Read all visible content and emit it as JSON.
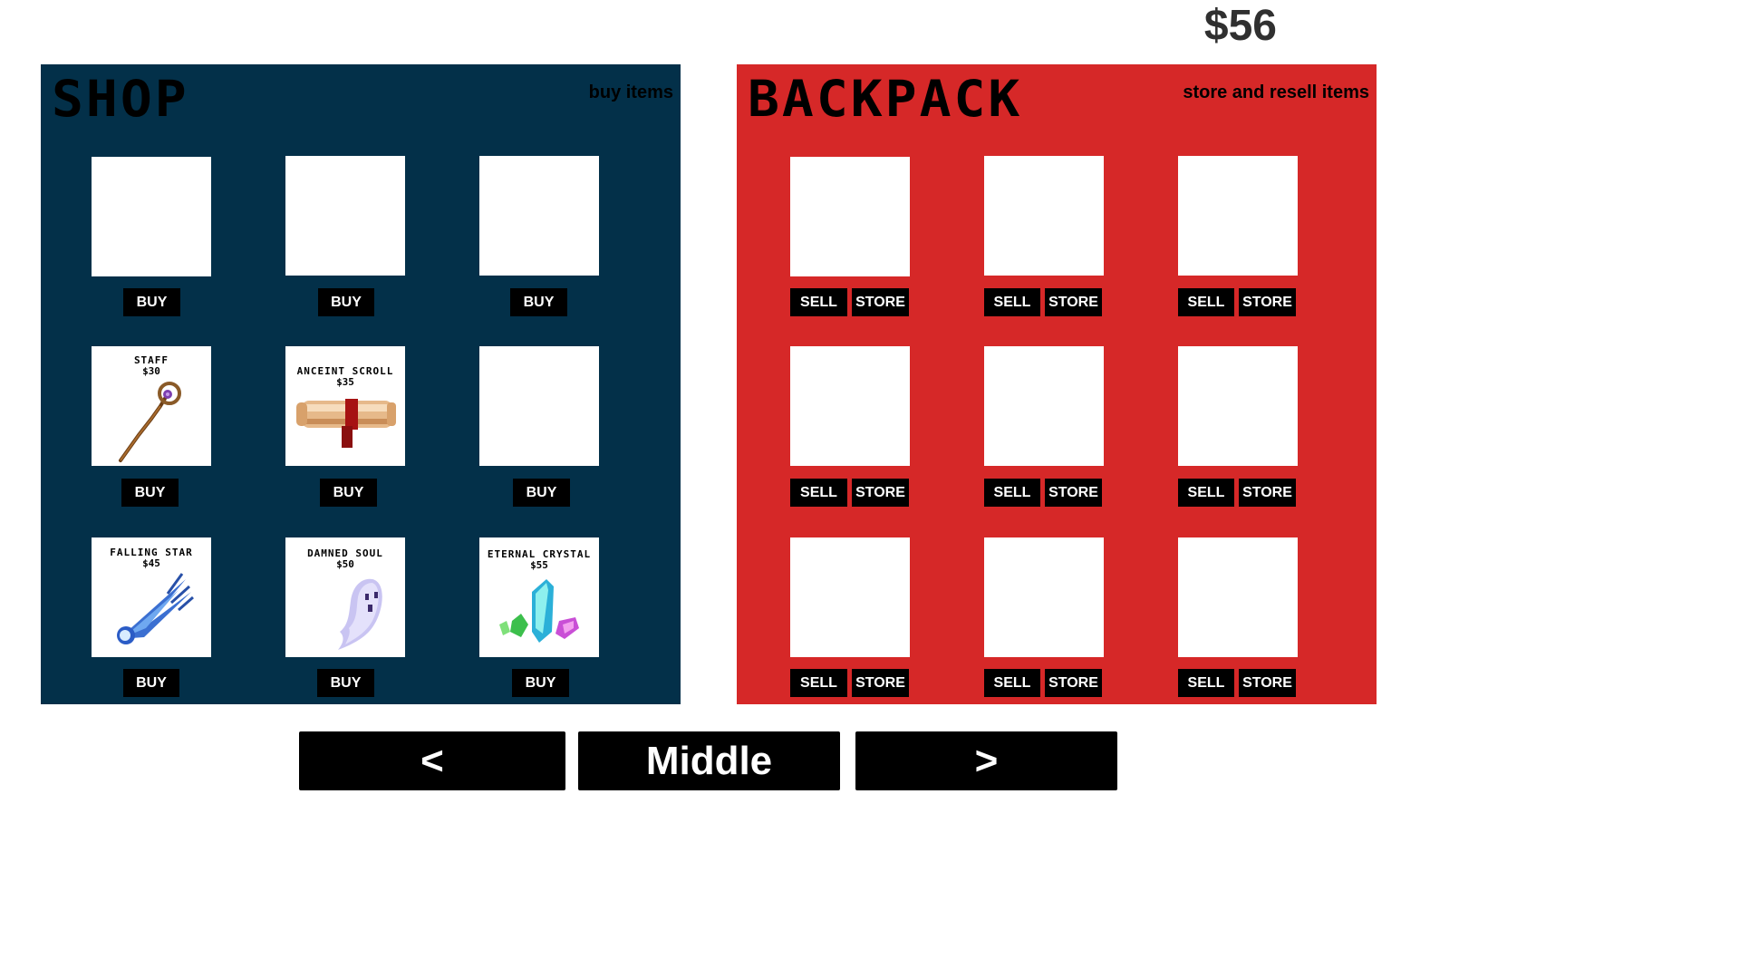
{
  "money": "$56",
  "shop": {
    "title": "SHOP",
    "subtitle": "buy items",
    "buy_label": "BUY",
    "slots": [
      {
        "name": "",
        "price": ""
      },
      {
        "name": "",
        "price": ""
      },
      {
        "name": "",
        "price": ""
      },
      {
        "name": "STAFF",
        "price": "$30",
        "icon": "staff-icon"
      },
      {
        "name": "ANCEINT SCROLL",
        "price": "$35",
        "icon": "scroll-icon"
      },
      {
        "name": "",
        "price": ""
      },
      {
        "name": "FALLING STAR",
        "price": "$45",
        "icon": "falling-star-icon"
      },
      {
        "name": "DAMNED SOUL",
        "price": "$50",
        "icon": "ghost-icon"
      },
      {
        "name": "ETERNAL CRYSTAL",
        "price": "$55",
        "icon": "crystal-icon"
      }
    ]
  },
  "backpack": {
    "title": "BACKPACK",
    "subtitle": "store and resell items",
    "sell_label": "SELL",
    "store_label": "STORE"
  },
  "nav": {
    "prev": "<",
    "middle": "Middle",
    "next": ">"
  },
  "colors": {
    "shop_bg": "#033049",
    "backpack_bg": "#d62828"
  }
}
